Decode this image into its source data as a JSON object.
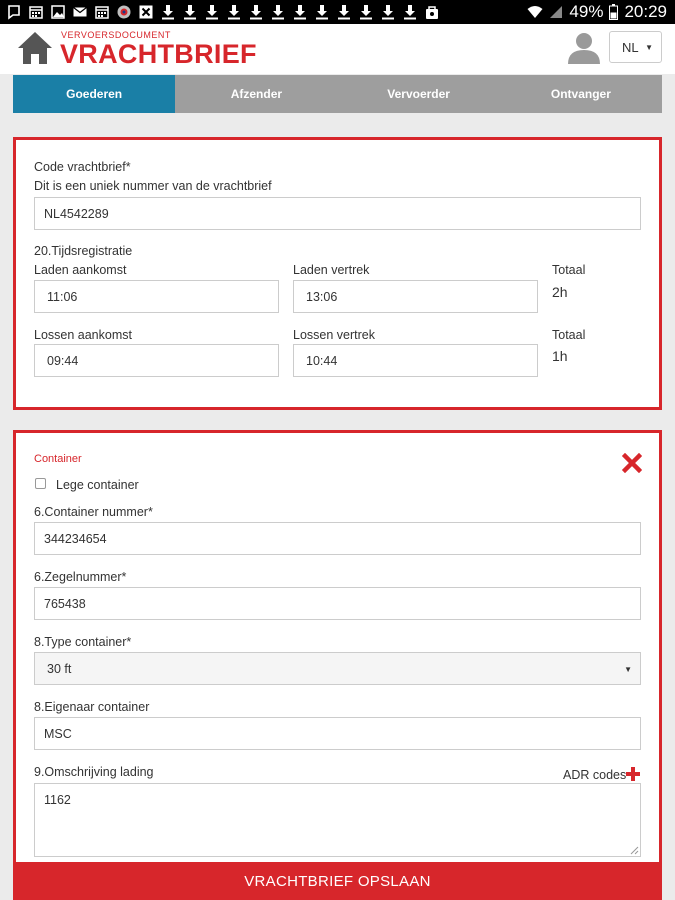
{
  "status_bar": {
    "battery": "49%",
    "time": "20:29",
    "left_icons": [
      "notification-icon",
      "calendar-icon",
      "image-icon",
      "mail-icon",
      "calendar-icon",
      "security-icon",
      "close-box-icon",
      "download-icon",
      "download-icon",
      "download-icon",
      "download-icon",
      "download-icon",
      "download-icon",
      "download-icon",
      "download-icon",
      "download-icon",
      "download-icon",
      "download-icon",
      "download-icon",
      "bag-icon"
    ]
  },
  "header": {
    "brand_small": "VERVOERSDOCUMENT",
    "brand_title": "VRACHTBRIEF",
    "language": "NL"
  },
  "tabs": [
    {
      "label": "Goederen",
      "active": true
    },
    {
      "label": "Afzender",
      "active": false
    },
    {
      "label": "Vervoerder",
      "active": false
    },
    {
      "label": "Ontvanger",
      "active": false
    }
  ],
  "code_section": {
    "label": "Code vrachtbrief*",
    "help": "Dit is een uniek nummer van de vrachtbrief",
    "value": "NL4542289"
  },
  "time_registration": {
    "title": "20.Tijdsregistratie",
    "loading_arrival_label": "Laden aankomst",
    "loading_arrival_value": "11:06",
    "loading_departure_label": "Laden vertrek",
    "loading_departure_value": "13:06",
    "loading_total_label": "Totaal",
    "loading_total_value": "2h",
    "unloading_arrival_label": "Lossen aankomst",
    "unloading_arrival_value": "09:44",
    "unloading_departure_label": "Lossen vertrek",
    "unloading_departure_value": "10:44",
    "unloading_total_label": "Totaal",
    "unloading_total_value": "1h"
  },
  "container": {
    "section_label": "Container",
    "empty_label": "Lege container",
    "empty_checked": false,
    "number_label": "6.Container nummer*",
    "number_value": "344234654",
    "seal_label": "6.Zegelnummer*",
    "seal_value": "765438",
    "type_label": "8.Type container*",
    "type_value": "30 ft",
    "owner_label": "8.Eigenaar container",
    "owner_value": "MSC",
    "description_label": "9.Omschrijving lading",
    "adr_label": "ADR codes",
    "description_value": "1162"
  },
  "save_button": "VRACHTBRIEF OPSLAAN",
  "colors": {
    "brand_red": "#d7262b",
    "tab_active": "#1a7fa6",
    "tab_inactive": "#9e9e9e"
  }
}
